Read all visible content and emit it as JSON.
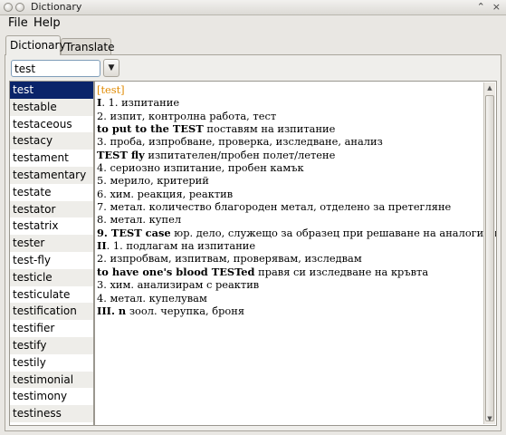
{
  "window": {
    "title": "Dictionary",
    "controls": [
      "⌃",
      "×"
    ]
  },
  "menu": {
    "file": "File",
    "help": "Help"
  },
  "tabs": [
    {
      "label": "Dictionary",
      "active": true
    },
    {
      "label": "Translate",
      "active": false
    }
  ],
  "search": {
    "value": "test"
  },
  "words": [
    "test",
    "testable",
    "testaceous",
    "testacy",
    "testament",
    "testamentary",
    "testate",
    "testator",
    "testatrix",
    "tester",
    "test-fly",
    "testicle",
    "testiculate",
    "testification",
    "testifier",
    "testify",
    "testily",
    "testimonial",
    "testimony",
    "testiness"
  ],
  "selected_word": "test",
  "definition": {
    "headword": "[test]",
    "lines": [
      {
        "bold": "I",
        "text": ". 1. изпитание"
      },
      {
        "bold": "",
        "text": "2. изпит, контролна работа, тест"
      },
      {
        "bold": "to put to the TEST",
        "text": " поставям на изпитание"
      },
      {
        "bold": "",
        "text": "3. проба, изпробване, проверка, изследване, анализ"
      },
      {
        "bold": "TEST fly",
        "text": " изпитателен/пробен полет/летене"
      },
      {
        "bold": "",
        "text": "4. сериозно изпитание, пробен камък"
      },
      {
        "bold": "",
        "text": "5. мерило, критерий"
      },
      {
        "bold": "",
        "text": "6. хим. реакция, реактив"
      },
      {
        "bold": "",
        "text": "7. метал. количество благороден метал, отделено за претегляне"
      },
      {
        "bold": "",
        "text": "8. метал. купел"
      },
      {
        "bold": "9. TEST case",
        "text": " юр. дело, служещо за образец при решаване на аналогични дела"
      },
      {
        "bold": "II",
        "text": ". 1. подлагам на изпитание"
      },
      {
        "bold": "",
        "text": "2. изпробвам, изпитвам, проверявам, изследвам"
      },
      {
        "bold": "to have one's blood TESTed",
        "text": " правя си изследване на кръвта"
      },
      {
        "bold": "",
        "text": "3. хим. анализирам с реактив"
      },
      {
        "bold": "",
        "text": "4. метал. купелувам"
      },
      {
        "bold": "III. n",
        "text": " зоол. черупка, броня"
      }
    ]
  },
  "colors": {
    "selection": "#0a246a",
    "headword": "#e08a00"
  }
}
